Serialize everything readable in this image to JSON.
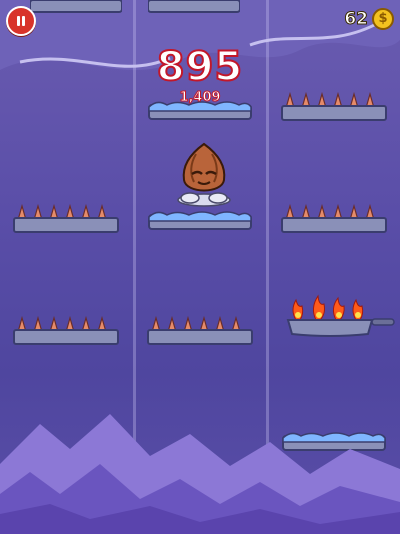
{
  "hud": {
    "score": "895",
    "best_score": "1,409",
    "coins": "62",
    "coin_symbol": "$"
  },
  "colors": {
    "sky": "#5a4ea8",
    "platform_ice_top": "#7fb6ff",
    "platform_stone": "#8a90b8",
    "spikes": "#e58b6a",
    "fire": "#ff5a1a",
    "score_outline": "#c2172a",
    "pause_button": "#d8342a"
  },
  "icons": [
    "pause-icon",
    "coin-icon"
  ]
}
